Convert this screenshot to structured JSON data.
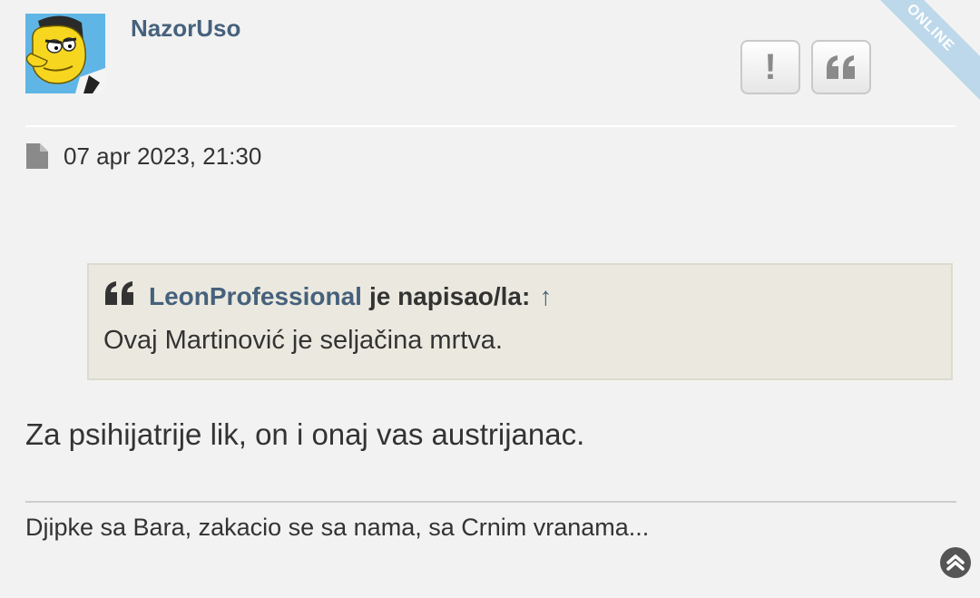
{
  "post": {
    "author": "NazorUso",
    "status": "ONLINE",
    "date": "07 apr 2023, 21:30",
    "body": "Za psihijatrije lik, on i onaj vas austrijanac.",
    "signature": "Djipke sa Bara, zakacio se sa nama, sa Crnim vranama..."
  },
  "buttons": {
    "report_label": "!",
    "report_icon": "exclamation-icon",
    "quote_icon": "quote-icon"
  },
  "quote": {
    "author": "LeonProfessional",
    "wrote": "je napisao/la:",
    "arrow": "↑",
    "text": "Ovaj Martinović je seljačina mrtva."
  },
  "colors": {
    "background": "#f2f2f2",
    "link": "#46617c",
    "quote_background": "#ebe9df",
    "ribbon": "#bcd8ea"
  }
}
